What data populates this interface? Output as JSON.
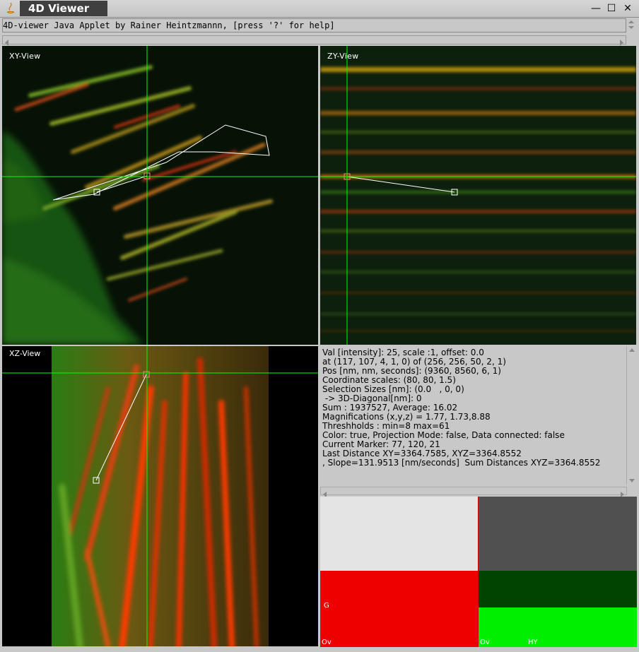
{
  "window": {
    "title": "4D Viewer",
    "controls": {
      "minimize": "—",
      "maximize": "☐",
      "close": "✕"
    }
  },
  "status_field": {
    "text": "4D-viewer Java Applet by Rainer Heintzmannn, [press '?' for help]"
  },
  "views": {
    "xy": {
      "label": "XY-View"
    },
    "zy": {
      "label": "ZY-View"
    },
    "xz": {
      "label": "XZ-View"
    }
  },
  "info_lines": [
    "Val [intensity]: 25, scale :1, offset: 0.0",
    "at (117, 107, 4, 1, 0) of (256, 256, 50, 2, 1)",
    "Pos [nm, nm, seconds]: (9360, 8560, 6, 1)",
    "Coordinate scales: (80, 80, 1.5)",
    "Selection Sizes [nm]: (0.0   , 0, 0)",
    " -> 3D-Diagonal[nm]: 0",
    "Sum : 1937527, Average: 16.02",
    "Magnifications (x,y,z) = 1.77, 1.73,8.88",
    "Threshholds : min=8 max=61",
    "Color: true, Projection Mode: false, Data connected: false",
    "Current Marker: 77, 120, 21",
    "Last Distance XY=3364.7585, XYZ=3364.8552",
    ", Slope=131.9513 [nm/seconds]  Sum Distances XYZ=3364.8552"
  ],
  "lut_labels": {
    "g": "G",
    "ov_left": "Ov",
    "ov_right": "Ov",
    "hy": "HY"
  },
  "colors": {
    "crosshair": "#00ff00",
    "lut_light_gray": "#e4e4e4",
    "lut_dark_gray": "#505050",
    "lut_red": "#ee0000",
    "lut_dark_green": "#004400",
    "lut_green": "#00ee00"
  }
}
